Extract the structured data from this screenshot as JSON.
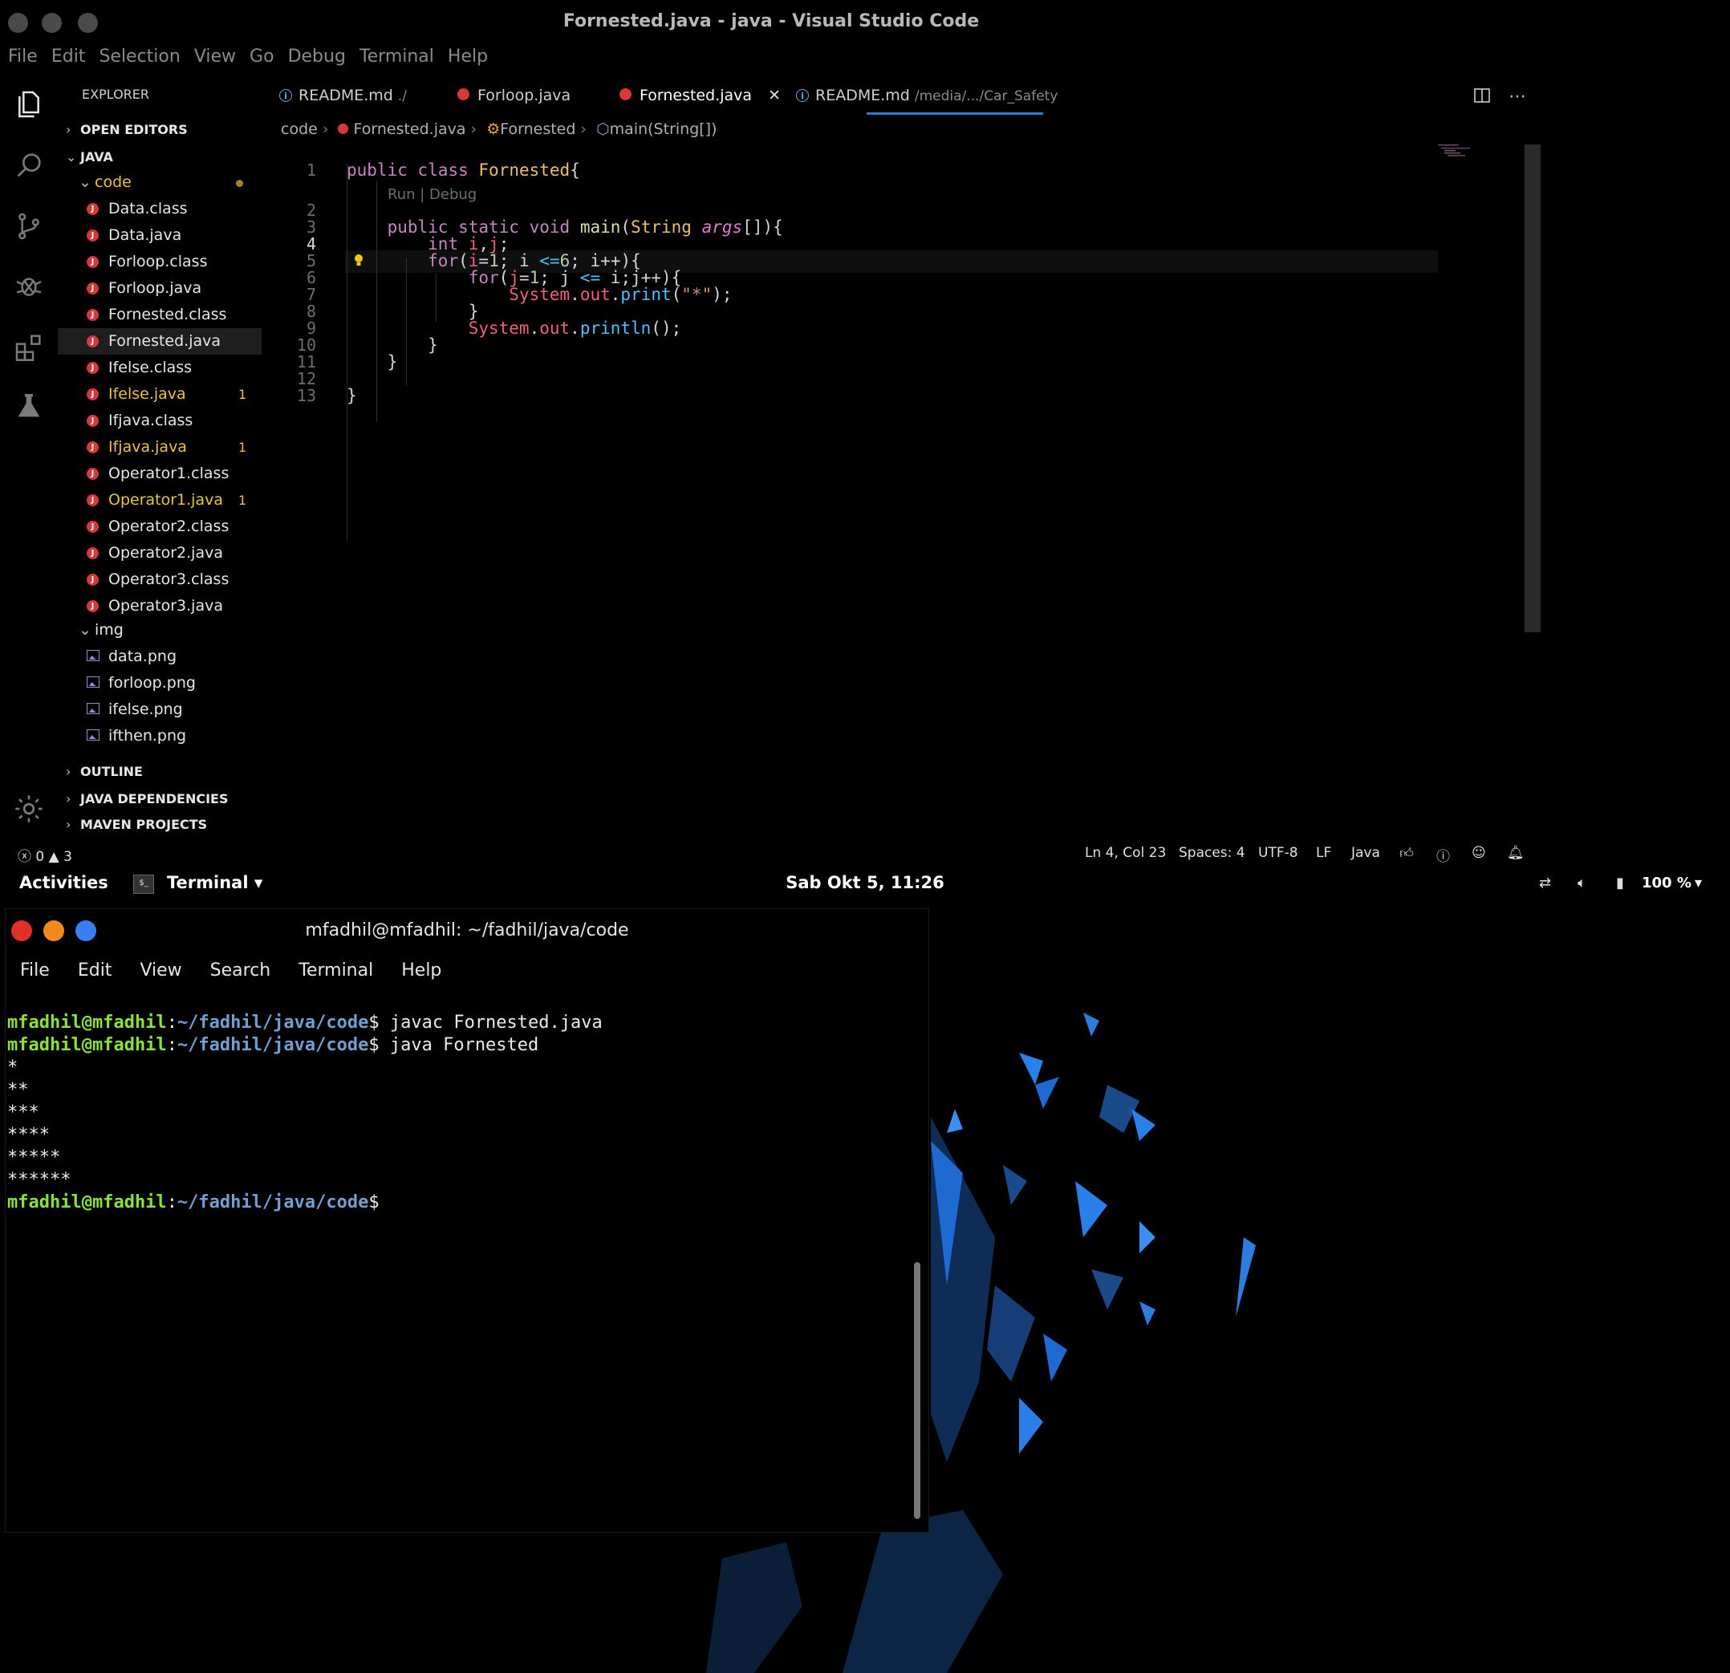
{
  "vscode": {
    "title": "Fornested.java - java - Visual Studio Code",
    "menu": [
      "File",
      "Edit",
      "Selection",
      "View",
      "Go",
      "Debug",
      "Terminal",
      "Help"
    ],
    "explorer": {
      "header": "EXPLORER",
      "sections": {
        "open_editors": "OPEN EDITORS",
        "java": "JAVA",
        "outline": "OUTLINE",
        "java_deps": "JAVA DEPENDENCIES",
        "maven": "MAVEN PROJECTS"
      },
      "code_folder": "code",
      "img_folder": "img",
      "files": [
        {
          "name": "Data.class",
          "badge": ""
        },
        {
          "name": "Data.java",
          "badge": ""
        },
        {
          "name": "Forloop.class",
          "badge": ""
        },
        {
          "name": "Forloop.java",
          "badge": ""
        },
        {
          "name": "Fornested.class",
          "badge": ""
        },
        {
          "name": "Fornested.java",
          "badge": ""
        },
        {
          "name": "Ifelse.class",
          "badge": ""
        },
        {
          "name": "Ifelse.java",
          "badge": "1"
        },
        {
          "name": "Ifjava.class",
          "badge": ""
        },
        {
          "name": "Ifjava.java",
          "badge": "1"
        },
        {
          "name": "Operator1.class",
          "badge": ""
        },
        {
          "name": "Operator1.java",
          "badge": "1"
        },
        {
          "name": "Operator2.class",
          "badge": ""
        },
        {
          "name": "Operator2.java",
          "badge": ""
        },
        {
          "name": "Operator3.class",
          "badge": ""
        },
        {
          "name": "Operator3.java",
          "badge": ""
        }
      ],
      "images": [
        "data.png",
        "forloop.png",
        "ifelse.png",
        "ifthen.png"
      ]
    },
    "tabs": [
      {
        "label": "README.md",
        "path": "./"
      },
      {
        "label": "Forloop.java",
        "path": ""
      },
      {
        "label": "Fornested.java",
        "path": ""
      },
      {
        "label": "README.md",
        "path": "/media/.../Car_Safety"
      }
    ],
    "breadcrumb": [
      "code",
      "Fornested.java",
      "Fornested",
      "main(String[])"
    ],
    "codelens": "Run | Debug",
    "line_numbers": [
      "1",
      "2",
      "3",
      "4",
      "5",
      "6",
      "7",
      "8",
      "9",
      "10",
      "11",
      "12",
      "13"
    ],
    "status": {
      "errors": "0",
      "warnings": "3",
      "position": "Ln 4, Col 23",
      "spaces": "Spaces: 4",
      "encoding": "UTF-8",
      "eol": "LF",
      "language": "Java"
    }
  },
  "topbar": {
    "activities": "Activities",
    "app": "Terminal",
    "clock": "Sab Okt  5, 11:26",
    "battery": "100 %"
  },
  "terminal": {
    "title": "mfadhil@mfadhil: ~/fadhil/java/code",
    "menu": [
      "File",
      "Edit",
      "View",
      "Search",
      "Terminal",
      "Help"
    ],
    "user": "mfadhil@mfadhil",
    "path": "~/fadhil/java/code",
    "cmd1": " javac Fornested.java",
    "cmd2": " java Fornested",
    "output": [
      "*",
      "**",
      "***",
      "****",
      "*****",
      "******"
    ]
  },
  "colors": {
    "accent": "#2d7bd6",
    "java_icon": "#d9383a",
    "warning": "#e9c43a",
    "prompt_user": "#8ae234",
    "prompt_path": "#729fcf"
  }
}
